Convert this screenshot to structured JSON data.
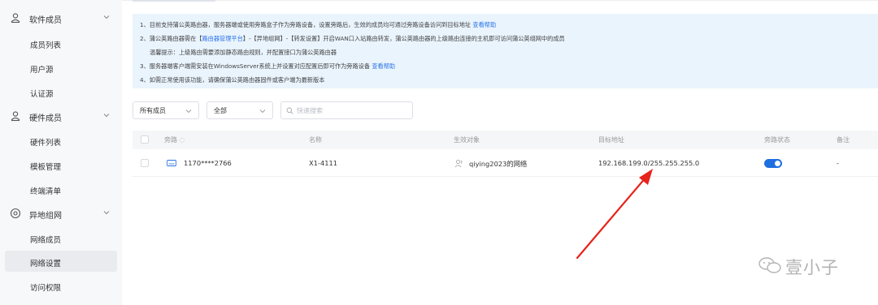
{
  "sidebar": {
    "groups": [
      {
        "label": "软件成员",
        "icon": "user-icon",
        "items": [
          "成员列表",
          "用户源",
          "认证源"
        ]
      },
      {
        "label": "硬件成员",
        "icon": "hardware-user-icon",
        "items": [
          "硬件列表",
          "模板管理",
          "终端清单"
        ]
      },
      {
        "label": "异地组网",
        "icon": "network-icon",
        "items": [
          "网络成员",
          "网络设置",
          "访问权限"
        ]
      }
    ],
    "active_item": "网络设置"
  },
  "notice": {
    "line1": "1、目前支持蒲公英路由器，服务器端或使用旁路盒子作为旁路设备，设置旁路后，生效的成员均可通过旁路设备访问到目标地址",
    "line1_link": "查看帮助",
    "line2_pre": "2、蒲公英路由器需在【",
    "line2_link": "路由器管理平台",
    "line2_post": "】-【异地组网】-【转发设置】开启WAN口入站路由转发，蒲公英路由器的上级路由连接的主机即可访问蒲公英组网中的成员",
    "line3": "温馨提示：上级路由需要添加静态路由规则，并配置接口为蒲公英路由器",
    "line4": "3、服务器端客户端需安装在WindowsServer系统上并设置对应配置后即可作为旁路设备",
    "line4_link": "查看帮助",
    "line5": "4、如需正常使用该功能，请确保蒲公英路由器固件或客户端为最新版本"
  },
  "filters": {
    "member_select": "所有成员",
    "type_select": "全部",
    "search_placeholder": "快速搜索"
  },
  "table": {
    "headers": [
      "旁路",
      "名称",
      "生效对象",
      "目标地址",
      "旁路状态",
      "备注"
    ],
    "rows": [
      {
        "bypass": "1170****2766",
        "name": "X1-4111",
        "target": "qiying2023的网络",
        "address": "192.168.199.0/255.255.255.0",
        "status_on": true,
        "remark": "-"
      }
    ]
  },
  "watermark": {
    "text": "壹小子",
    "icon": "wechat-icon"
  },
  "colors": {
    "accent": "#1f6fe0",
    "link": "#2a73e8",
    "notice_bg": "#eaf4fd",
    "arrow": "#e8231c"
  }
}
